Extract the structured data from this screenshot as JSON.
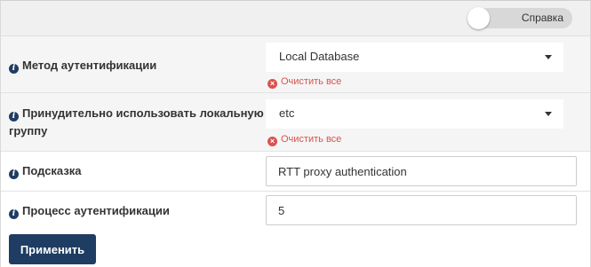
{
  "header": {
    "help_toggle_label": "Справка"
  },
  "fields": {
    "auth_method": {
      "label": "Метод аутентификации",
      "value": "Local Database",
      "clear_label": "Очистить все"
    },
    "force_local_group": {
      "label_line1": "Принудительно использовать локальную",
      "label_line2": "группу",
      "value": "etc",
      "clear_label": "Очистить все"
    },
    "hint": {
      "label": "Подсказка",
      "value": "RTT proxy authentication"
    },
    "auth_process": {
      "label": "Процесс аутентификации",
      "value": "5"
    }
  },
  "actions": {
    "apply_label": "Применить"
  },
  "icons": {
    "info": "info-circle-icon",
    "clear": "times-circle-icon",
    "dropdown": "caret-down-icon"
  },
  "colors": {
    "primary": "#1f3d63",
    "danger": "#d9534f",
    "row_alt": "#f5f5f5"
  }
}
